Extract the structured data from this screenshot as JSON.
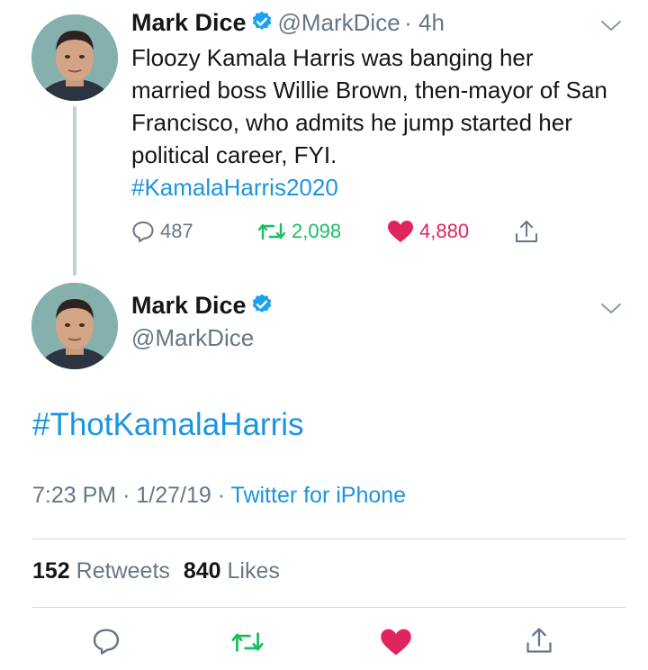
{
  "first_tweet": {
    "author_name": "Mark Dice",
    "handle": "@MarkDice",
    "time": "· 4h",
    "text": "Floozy Kamala Harris was banging her married boss Willie Brown, then-mayor of San Francisco, who admits he jump started her political career, FYI.",
    "hashtag": "#KamalaHarris2020",
    "replies": "487",
    "retweets": "2,098",
    "likes": "4,880"
  },
  "second_tweet": {
    "author_name": "Mark Dice",
    "handle": "@MarkDice",
    "hashtag": "#ThotKamalaHarris",
    "time": "7:23 PM",
    "date": "1/27/19",
    "client": "Twitter for iPhone",
    "retweet_count": "152",
    "retweets_label": "Retweets",
    "like_count": "840",
    "likes_label": "Likes"
  },
  "colors": {
    "brand_blue": "#1b95e0",
    "retweet_green": "#17bf63",
    "like_red": "#e0245e",
    "muted_gray": "#657786"
  },
  "icons": [
    "verified-badge-icon",
    "chevron-down-icon",
    "reply-icon",
    "retweet-icon",
    "like-icon",
    "share-icon"
  ]
}
